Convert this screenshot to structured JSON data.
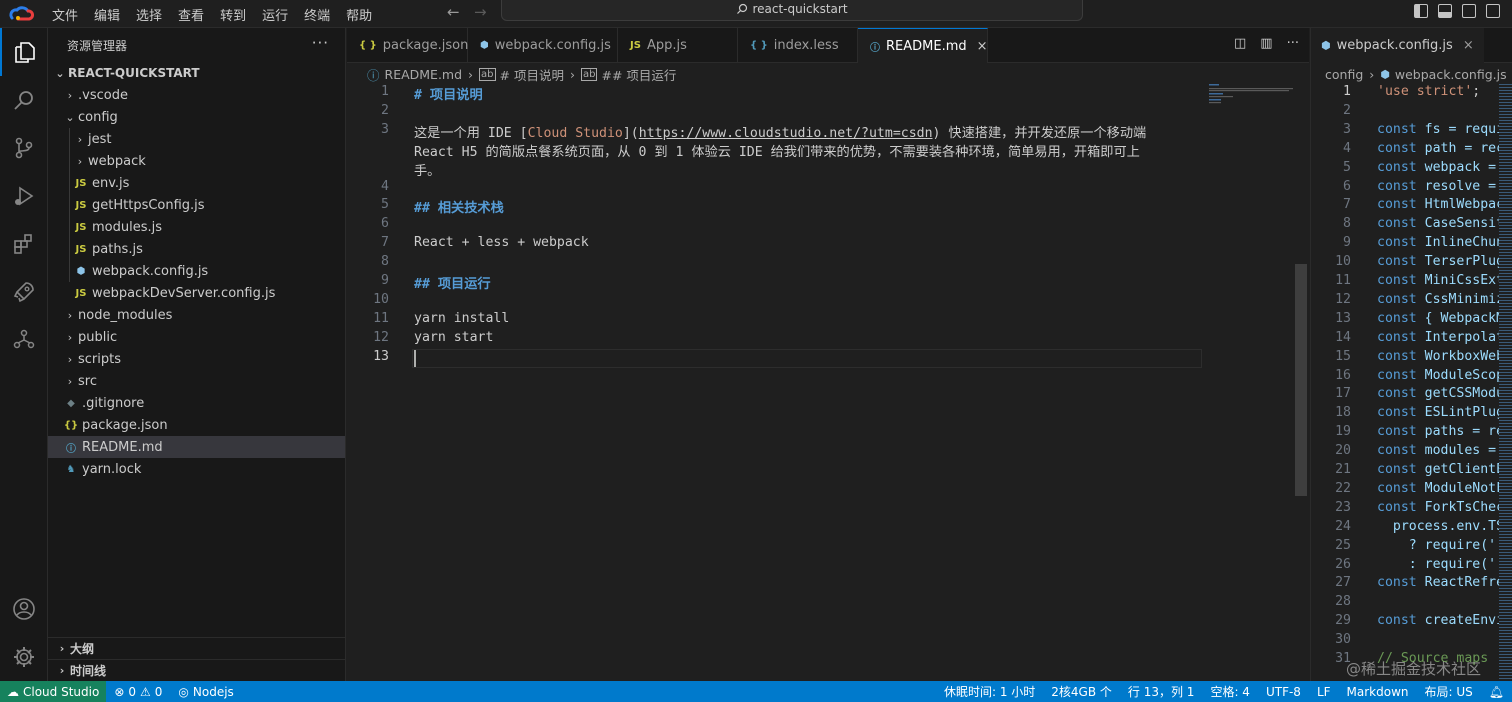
{
  "menu": [
    "文件",
    "编辑",
    "选择",
    "查看",
    "转到",
    "运行",
    "终端",
    "帮助"
  ],
  "search": {
    "text": "react-quickstart"
  },
  "sidebar": {
    "title": "资源管理器",
    "root": "REACT-QUICKSTART",
    "items": [
      {
        "label": ".vscode",
        "type": "folder",
        "depth": 1,
        "open": false
      },
      {
        "label": "config",
        "type": "folder",
        "depth": 1,
        "open": true
      },
      {
        "label": "jest",
        "type": "folder",
        "depth": 2,
        "open": false
      },
      {
        "label": "webpack",
        "type": "folder",
        "depth": 2,
        "open": false
      },
      {
        "label": "env.js",
        "type": "js",
        "depth": 2
      },
      {
        "label": "getHttpsConfig.js",
        "type": "js",
        "depth": 2
      },
      {
        "label": "modules.js",
        "type": "js",
        "depth": 2
      },
      {
        "label": "paths.js",
        "type": "js",
        "depth": 2
      },
      {
        "label": "webpack.config.js",
        "type": "gear",
        "depth": 2
      },
      {
        "label": "webpackDevServer.config.js",
        "type": "js",
        "depth": 2
      },
      {
        "label": "node_modules",
        "type": "folder",
        "depth": 1,
        "open": false
      },
      {
        "label": "public",
        "type": "folder",
        "depth": 1,
        "open": false
      },
      {
        "label": "scripts",
        "type": "folder",
        "depth": 1,
        "open": false
      },
      {
        "label": "src",
        "type": "folder",
        "depth": 1,
        "open": false
      },
      {
        "label": ".gitignore",
        "type": "git",
        "depth": 1
      },
      {
        "label": "package.json",
        "type": "json",
        "depth": 1
      },
      {
        "label": "README.md",
        "type": "info",
        "depth": 1,
        "selected": true
      },
      {
        "label": "yarn.lock",
        "type": "yarn",
        "depth": 1
      }
    ],
    "outline": "大纲",
    "timeline": "时间线"
  },
  "tabs": [
    {
      "label": "package.json",
      "icon": "{ }"
    },
    {
      "label": "webpack.config.js",
      "icon": "⬢"
    },
    {
      "label": "App.js",
      "icon": "JS"
    },
    {
      "label": "index.less",
      "icon": "{ }"
    },
    {
      "label": "README.md",
      "icon": "ⓘ",
      "active": true,
      "close": "×"
    }
  ],
  "breadcrumb": {
    "file": "README.md",
    "h1": "# 项目说明",
    "h2": "## 项目运行"
  },
  "editor_lines": [
    {
      "n": "1",
      "text": "# 项目说明",
      "kind": "h"
    },
    {
      "n": "2",
      "text": ""
    },
    {
      "n": "3",
      "text": "",
      "kind": "p"
    },
    {
      "n": "",
      "text": "React H5 的简版点餐系统页面，从 0 到 1 体验云 IDE 给我们带来的优势，不需要装各种环境，简单易用，开箱即可上"
    },
    {
      "n": "",
      "text": "手。"
    },
    {
      "n": "4",
      "text": ""
    },
    {
      "n": "5",
      "text": "## 相关技术栈",
      "kind": "h"
    },
    {
      "n": "6",
      "text": ""
    },
    {
      "n": "7",
      "text": "React + less + webpack"
    },
    {
      "n": "8",
      "text": ""
    },
    {
      "n": "9",
      "text": "## 项目运行",
      "kind": "h"
    },
    {
      "n": "10",
      "text": ""
    },
    {
      "n": "11",
      "text": "yarn install"
    },
    {
      "n": "12",
      "text": "yarn start"
    },
    {
      "n": "13",
      "text": ""
    }
  ],
  "line3": {
    "pre": "这是一个用 IDE [",
    "link": "Cloud Studio",
    "mid": "](",
    "url": "https://www.cloudstudio.net/?utm=csdn",
    "post": ") 快速搭建，并开发还原一个移动端"
  },
  "right": {
    "tab": "webpack.config.js",
    "close": "×",
    "bc_folder": "config",
    "bc_file": "webpack.config.js",
    "lines": [
      {
        "n": "1",
        "parts": [
          [
            "str",
            "'use strict'"
          ],
          [
            "p",
            ";"
          ]
        ]
      },
      {
        "n": "2",
        "parts": []
      },
      {
        "n": "3",
        "parts": [
          [
            "kw",
            "const "
          ],
          [
            "v",
            "fs = requi"
          ]
        ]
      },
      {
        "n": "4",
        "parts": [
          [
            "kw",
            "const "
          ],
          [
            "v",
            "path = rec"
          ]
        ]
      },
      {
        "n": "5",
        "parts": [
          [
            "kw",
            "const "
          ],
          [
            "v",
            "webpack = "
          ]
        ]
      },
      {
        "n": "6",
        "parts": [
          [
            "kw",
            "const "
          ],
          [
            "v",
            "resolve = "
          ]
        ]
      },
      {
        "n": "7",
        "parts": [
          [
            "kw",
            "const "
          ],
          [
            "v",
            "HtmlWebpac"
          ]
        ]
      },
      {
        "n": "8",
        "parts": [
          [
            "kw",
            "const "
          ],
          [
            "v",
            "CaseSensit"
          ]
        ]
      },
      {
        "n": "9",
        "parts": [
          [
            "kw",
            "const "
          ],
          [
            "v",
            "InlineChun"
          ]
        ]
      },
      {
        "n": "10",
        "parts": [
          [
            "kw",
            "const "
          ],
          [
            "v",
            "TerserPlug"
          ]
        ]
      },
      {
        "n": "11",
        "parts": [
          [
            "kw",
            "const "
          ],
          [
            "v",
            "MiniCssExt"
          ]
        ]
      },
      {
        "n": "12",
        "parts": [
          [
            "kw",
            "const "
          ],
          [
            "v",
            "CssMinimiz"
          ]
        ]
      },
      {
        "n": "13",
        "parts": [
          [
            "kw",
            "const "
          ],
          [
            "v",
            "{ WebpackM"
          ]
        ]
      },
      {
        "n": "14",
        "parts": [
          [
            "kw",
            "const "
          ],
          [
            "v",
            "Interpolat"
          ]
        ]
      },
      {
        "n": "15",
        "parts": [
          [
            "kw",
            "const "
          ],
          [
            "v",
            "WorkboxWeb"
          ]
        ]
      },
      {
        "n": "16",
        "parts": [
          [
            "kw",
            "const "
          ],
          [
            "v",
            "ModuleScop"
          ]
        ]
      },
      {
        "n": "17",
        "parts": [
          [
            "kw",
            "const "
          ],
          [
            "v",
            "getCSSModu"
          ]
        ]
      },
      {
        "n": "18",
        "parts": [
          [
            "kw",
            "const "
          ],
          [
            "v",
            "ESLintPlug"
          ]
        ]
      },
      {
        "n": "19",
        "parts": [
          [
            "kw",
            "const "
          ],
          [
            "v",
            "paths = re"
          ]
        ]
      },
      {
        "n": "20",
        "parts": [
          [
            "kw",
            "const "
          ],
          [
            "v",
            "modules = "
          ]
        ]
      },
      {
        "n": "21",
        "parts": [
          [
            "kw",
            "const "
          ],
          [
            "v",
            "getClientE"
          ]
        ]
      },
      {
        "n": "22",
        "parts": [
          [
            "kw",
            "const "
          ],
          [
            "v",
            "ModuleNotF"
          ]
        ]
      },
      {
        "n": "23",
        "parts": [
          [
            "kw",
            "const "
          ],
          [
            "v",
            "ForkTsChec"
          ]
        ]
      },
      {
        "n": "24",
        "parts": [
          [
            "v",
            "  process.env.TS"
          ]
        ]
      },
      {
        "n": "25",
        "parts": [
          [
            "v",
            "    ? require('"
          ]
        ]
      },
      {
        "n": "26",
        "parts": [
          [
            "v",
            "    : require('"
          ]
        ]
      },
      {
        "n": "27",
        "parts": [
          [
            "kw",
            "const "
          ],
          [
            "v",
            "ReactRefre"
          ]
        ]
      },
      {
        "n": "28",
        "parts": []
      },
      {
        "n": "29",
        "parts": [
          [
            "kw",
            "const "
          ],
          [
            "v",
            "createEnvi"
          ]
        ]
      },
      {
        "n": "30",
        "parts": []
      },
      {
        "n": "31",
        "parts": [
          [
            "cmt",
            "// Source maps "
          ]
        ]
      }
    ]
  },
  "watermark": "@稀土掘金技术社区",
  "status": {
    "remote": "Cloud Studio",
    "errors": "0",
    "warnings": "0",
    "env": "Nodejs",
    "rest": "休眠时间: 1 小时",
    "spec": "2核4GB 个",
    "pos": "行 13，列 1",
    "spaces": "空格: 4",
    "enc": "UTF-8",
    "eol": "LF",
    "lang": "Markdown",
    "layout": "布局: US"
  }
}
